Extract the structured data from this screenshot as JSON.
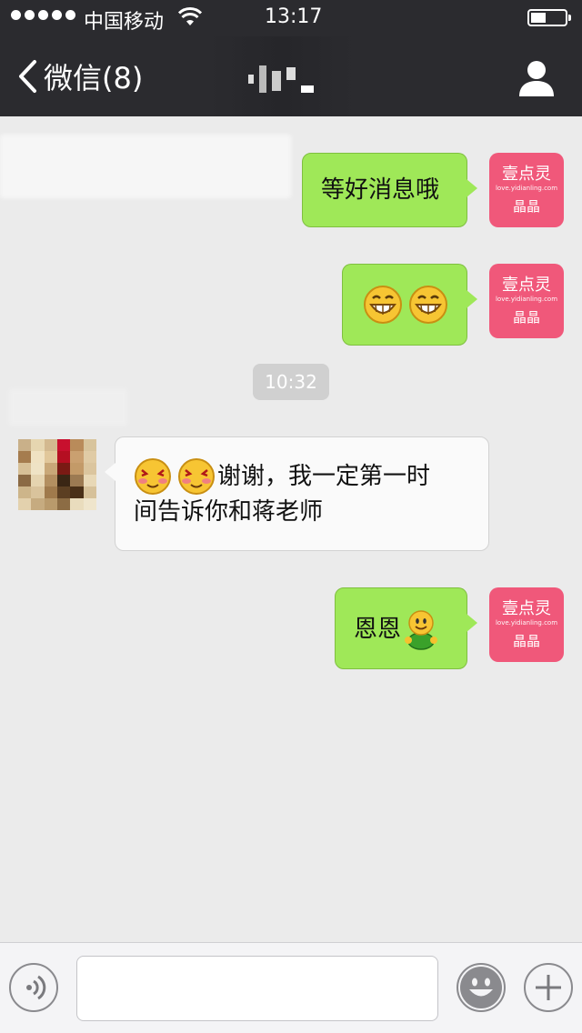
{
  "status_bar": {
    "carrier": "中国移动",
    "time": "13:17"
  },
  "nav": {
    "back_label": "微信(8)",
    "title": ""
  },
  "messages": [
    {
      "side": "right",
      "text": "等好消息哦",
      "sender": {
        "brand": "壹点灵",
        "url": "love.yidianling.com",
        "name": "晶晶"
      }
    },
    {
      "side": "right",
      "text": "",
      "emojis": [
        "grin-icon",
        "grin-icon"
      ],
      "sender": {
        "brand": "壹点灵",
        "url": "love.yidianling.com",
        "name": "晶晶"
      }
    },
    {
      "type": "timestamp",
      "text": "10:32"
    },
    {
      "side": "left",
      "emojis": [
        "blush-icon",
        "blush-icon"
      ],
      "text_line1": "谢谢，我一定第一时",
      "text_line2": "间告诉你和蒋老师"
    },
    {
      "side": "right",
      "text": "恩恩",
      "emojis": [
        "green-smiley-figure-icon"
      ],
      "sender": {
        "brand": "壹点灵",
        "url": "love.yidianling.com",
        "name": "晶晶"
      }
    }
  ],
  "input_bar": {
    "voice_icon": "voice-icon",
    "text_value": "",
    "emoji_icon": "emoji-icon",
    "add_icon": "plus-icon"
  },
  "colors": {
    "nav_bg": "#2b2b2f",
    "chat_bg": "#ebebeb",
    "outgoing_bubble": "#9fe858",
    "incoming_bubble": "#fafafa",
    "avatar_brand": "#f0587a"
  }
}
